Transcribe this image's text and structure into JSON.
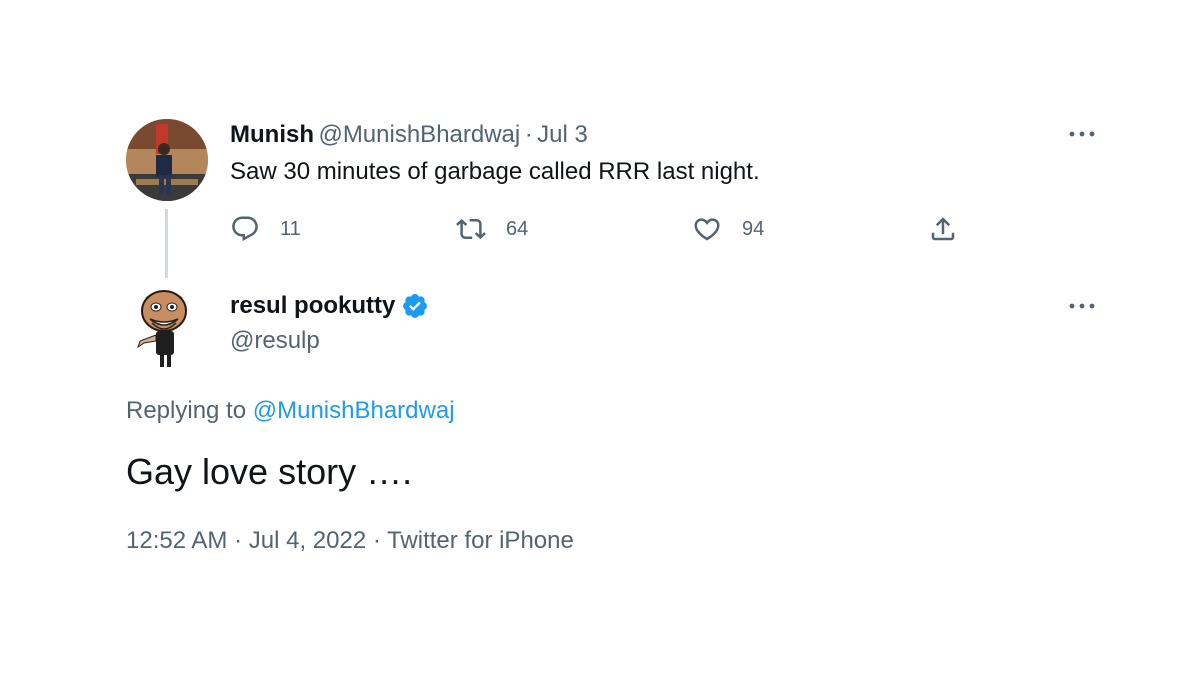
{
  "parent_tweet": {
    "author_name": "Munish",
    "author_handle": "@MunishBhardwaj",
    "separator": "·",
    "date": "Jul 3",
    "text": "Saw 30 minutes of garbage called RRR last night.",
    "replies_count": "11",
    "retweets_count": "64",
    "likes_count": "94",
    "more_icon": "more-icon"
  },
  "reply_tweet": {
    "author_name": "resul pookutty",
    "verified_icon": "verified-badge-icon",
    "author_handle": "@resulp",
    "replying_label": "Replying to",
    "replying_mention": "@MunishBhardwaj",
    "text": "Gay love story ….",
    "time": "12:52 AM",
    "separator": "·",
    "date": "Jul 4, 2022",
    "source": "Twitter for iPhone"
  },
  "colors": {
    "text_primary": "#0f1419",
    "text_secondary": "#536471",
    "link": "#1d9bf0",
    "thread_line": "#cfd9de"
  }
}
